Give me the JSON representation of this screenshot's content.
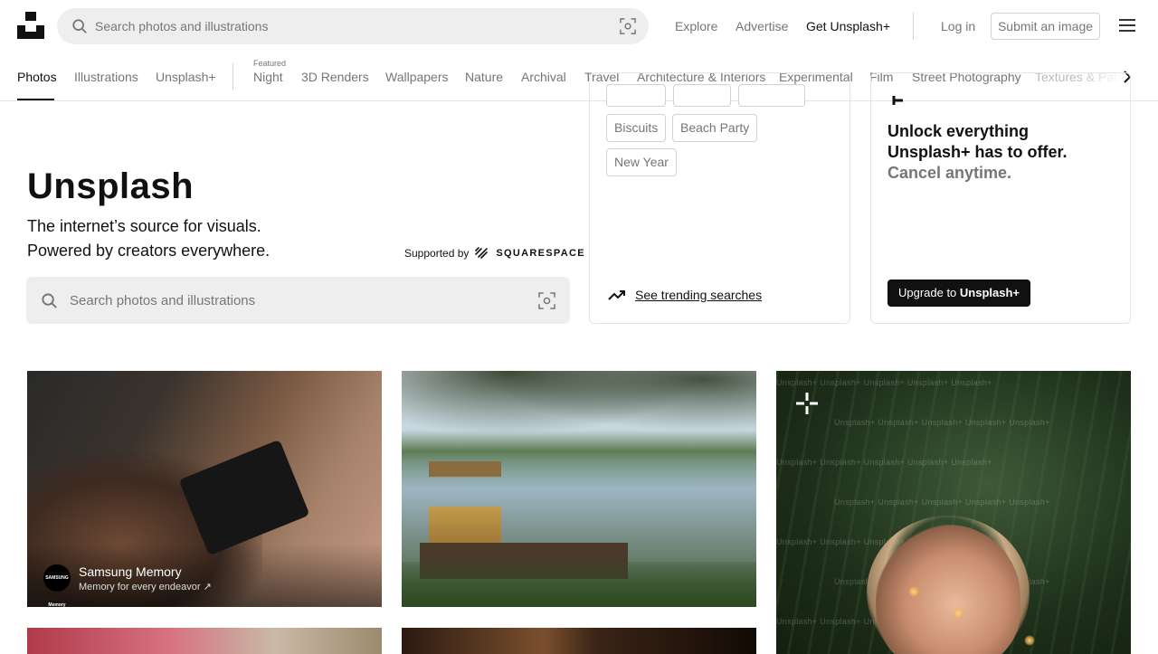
{
  "header": {
    "search_placeholder": "Search photos and illustrations",
    "nav": {
      "explore": "Explore",
      "advertise": "Advertise",
      "get_plus": "Get Unsplash+",
      "login": "Log in",
      "submit": "Submit an image"
    }
  },
  "tabs": {
    "items": [
      "Photos",
      "Illustrations",
      "Unsplash+"
    ],
    "featured_label": "Featured",
    "featured": [
      "Night",
      "3D Renders",
      "Wallpapers",
      "Nature",
      "Archival",
      "Travel",
      "Architecture & Interiors",
      "Experimental",
      "Film",
      "Street Photography",
      "Textures & Patterns"
    ],
    "active": "Photos"
  },
  "hero": {
    "title": "Unsplash",
    "line1": "The internet’s source for visuals.",
    "line2": "Powered by creators everywhere.",
    "supported_by": "Supported by",
    "sponsor": "SQUARESPACE",
    "search_placeholder": "Search photos and illustrations"
  },
  "trending": {
    "chips": [
      "Biscuits",
      "Beach Party",
      "New Year"
    ],
    "see_trending": "See trending searches"
  },
  "plus_card": {
    "line1": "Unlock everything",
    "line2": "Unsplash+ has to offer.",
    "line3": "Cancel anytime.",
    "button_prefix": "Upgrade to ",
    "button_brand": "Unsplash+"
  },
  "photos": {
    "sponsored": {
      "avatar_text": "SAMSUNG Memory",
      "name": "Samsung Memory",
      "tagline": "Memory for every endeavor ↗"
    },
    "watermark": "Unsplash+"
  },
  "colors": {
    "text_primary": "#111111",
    "text_secondary": "#767676",
    "search_bg": "#eeeeee",
    "border": "#d1d1d1"
  }
}
